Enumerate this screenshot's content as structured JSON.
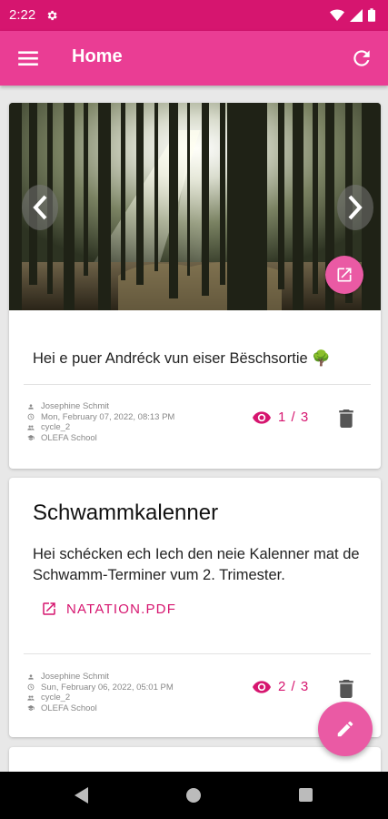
{
  "status_bar": {
    "time": "2:22",
    "icons": [
      "gear-icon",
      "wifi-icon",
      "signal-icon",
      "battery-icon"
    ]
  },
  "app_bar": {
    "title": "Home",
    "menu_icon": "menu-icon",
    "refresh_icon": "refresh-icon"
  },
  "colors": {
    "primary": "#ea3d94",
    "primary_dark": "#d6156f",
    "accent": "#ea5aa4"
  },
  "posts": [
    {
      "text": "Hei e puer Andréck vun eiser Bëschsortie 🌳",
      "author": "Josephine Schmit",
      "date": "Mon, February 07, 2022, 08:13 PM",
      "cycle": "cycle_2",
      "school": "OLEFA School",
      "views": "1 / 3"
    },
    {
      "title": "Schwammkalenner",
      "text": "Hei schécken ech Iech den neie Kalenner mat de Schwamm-Terminer vum 2. Trimester.",
      "attachment": "NATATION.PDF",
      "author": "Josephine Schmit",
      "date": "Sun, February 06, 2022, 05:01 PM",
      "cycle": "cycle_2",
      "school": "OLEFA School",
      "views": "2 / 3"
    }
  ]
}
